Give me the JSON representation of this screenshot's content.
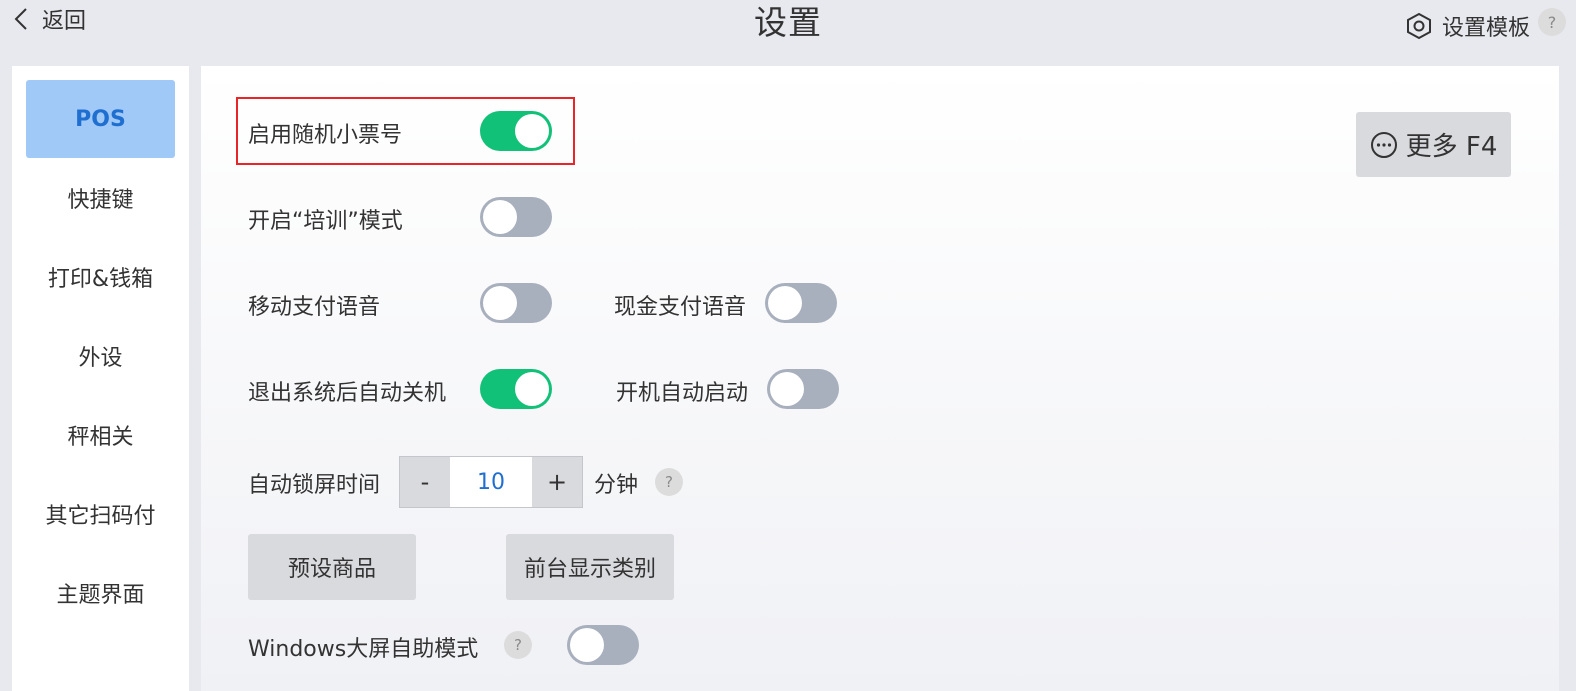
{
  "header": {
    "back_label": "返回",
    "title": "设置",
    "template_label": "设置模板",
    "help_label": "?"
  },
  "sidebar": {
    "items": [
      {
        "label": "POS",
        "active": true
      },
      {
        "label": "快捷键"
      },
      {
        "label": "打印&钱箱"
      },
      {
        "label": "外设"
      },
      {
        "label": "秤相关"
      },
      {
        "label": "其它扫码付"
      },
      {
        "label": "主题界面"
      }
    ]
  },
  "main": {
    "more_button": "更多 F4",
    "settings": {
      "random_ticket": {
        "label": "启用随机小票号",
        "on": true
      },
      "training_mode": {
        "label": "开启“培训”模式",
        "on": false
      },
      "mobile_pay_voice": {
        "label": "移动支付语音",
        "on": false
      },
      "cash_pay_voice": {
        "label": "现金支付语音",
        "on": false
      },
      "auto_shutdown": {
        "label": "退出系统后自动关机",
        "on": true
      },
      "auto_start": {
        "label": "开机自动启动",
        "on": false
      },
      "windows_kiosk": {
        "label": "Windows大屏自助模式",
        "on": false
      }
    },
    "lock_screen": {
      "label": "自动锁屏时间",
      "minus": "-",
      "value": "10",
      "plus": "+",
      "unit": "分钟",
      "help": "?"
    },
    "preset_goods_button": "预设商品",
    "front_category_button": "前台显示类别",
    "windows_help": "?"
  },
  "colors": {
    "toggle_on": "#12c178",
    "toggle_off": "#a8afbd",
    "active_nav_bg": "#a1c9f7",
    "active_nav_text": "#1f6fd1",
    "highlight_border": "#e8262a"
  }
}
